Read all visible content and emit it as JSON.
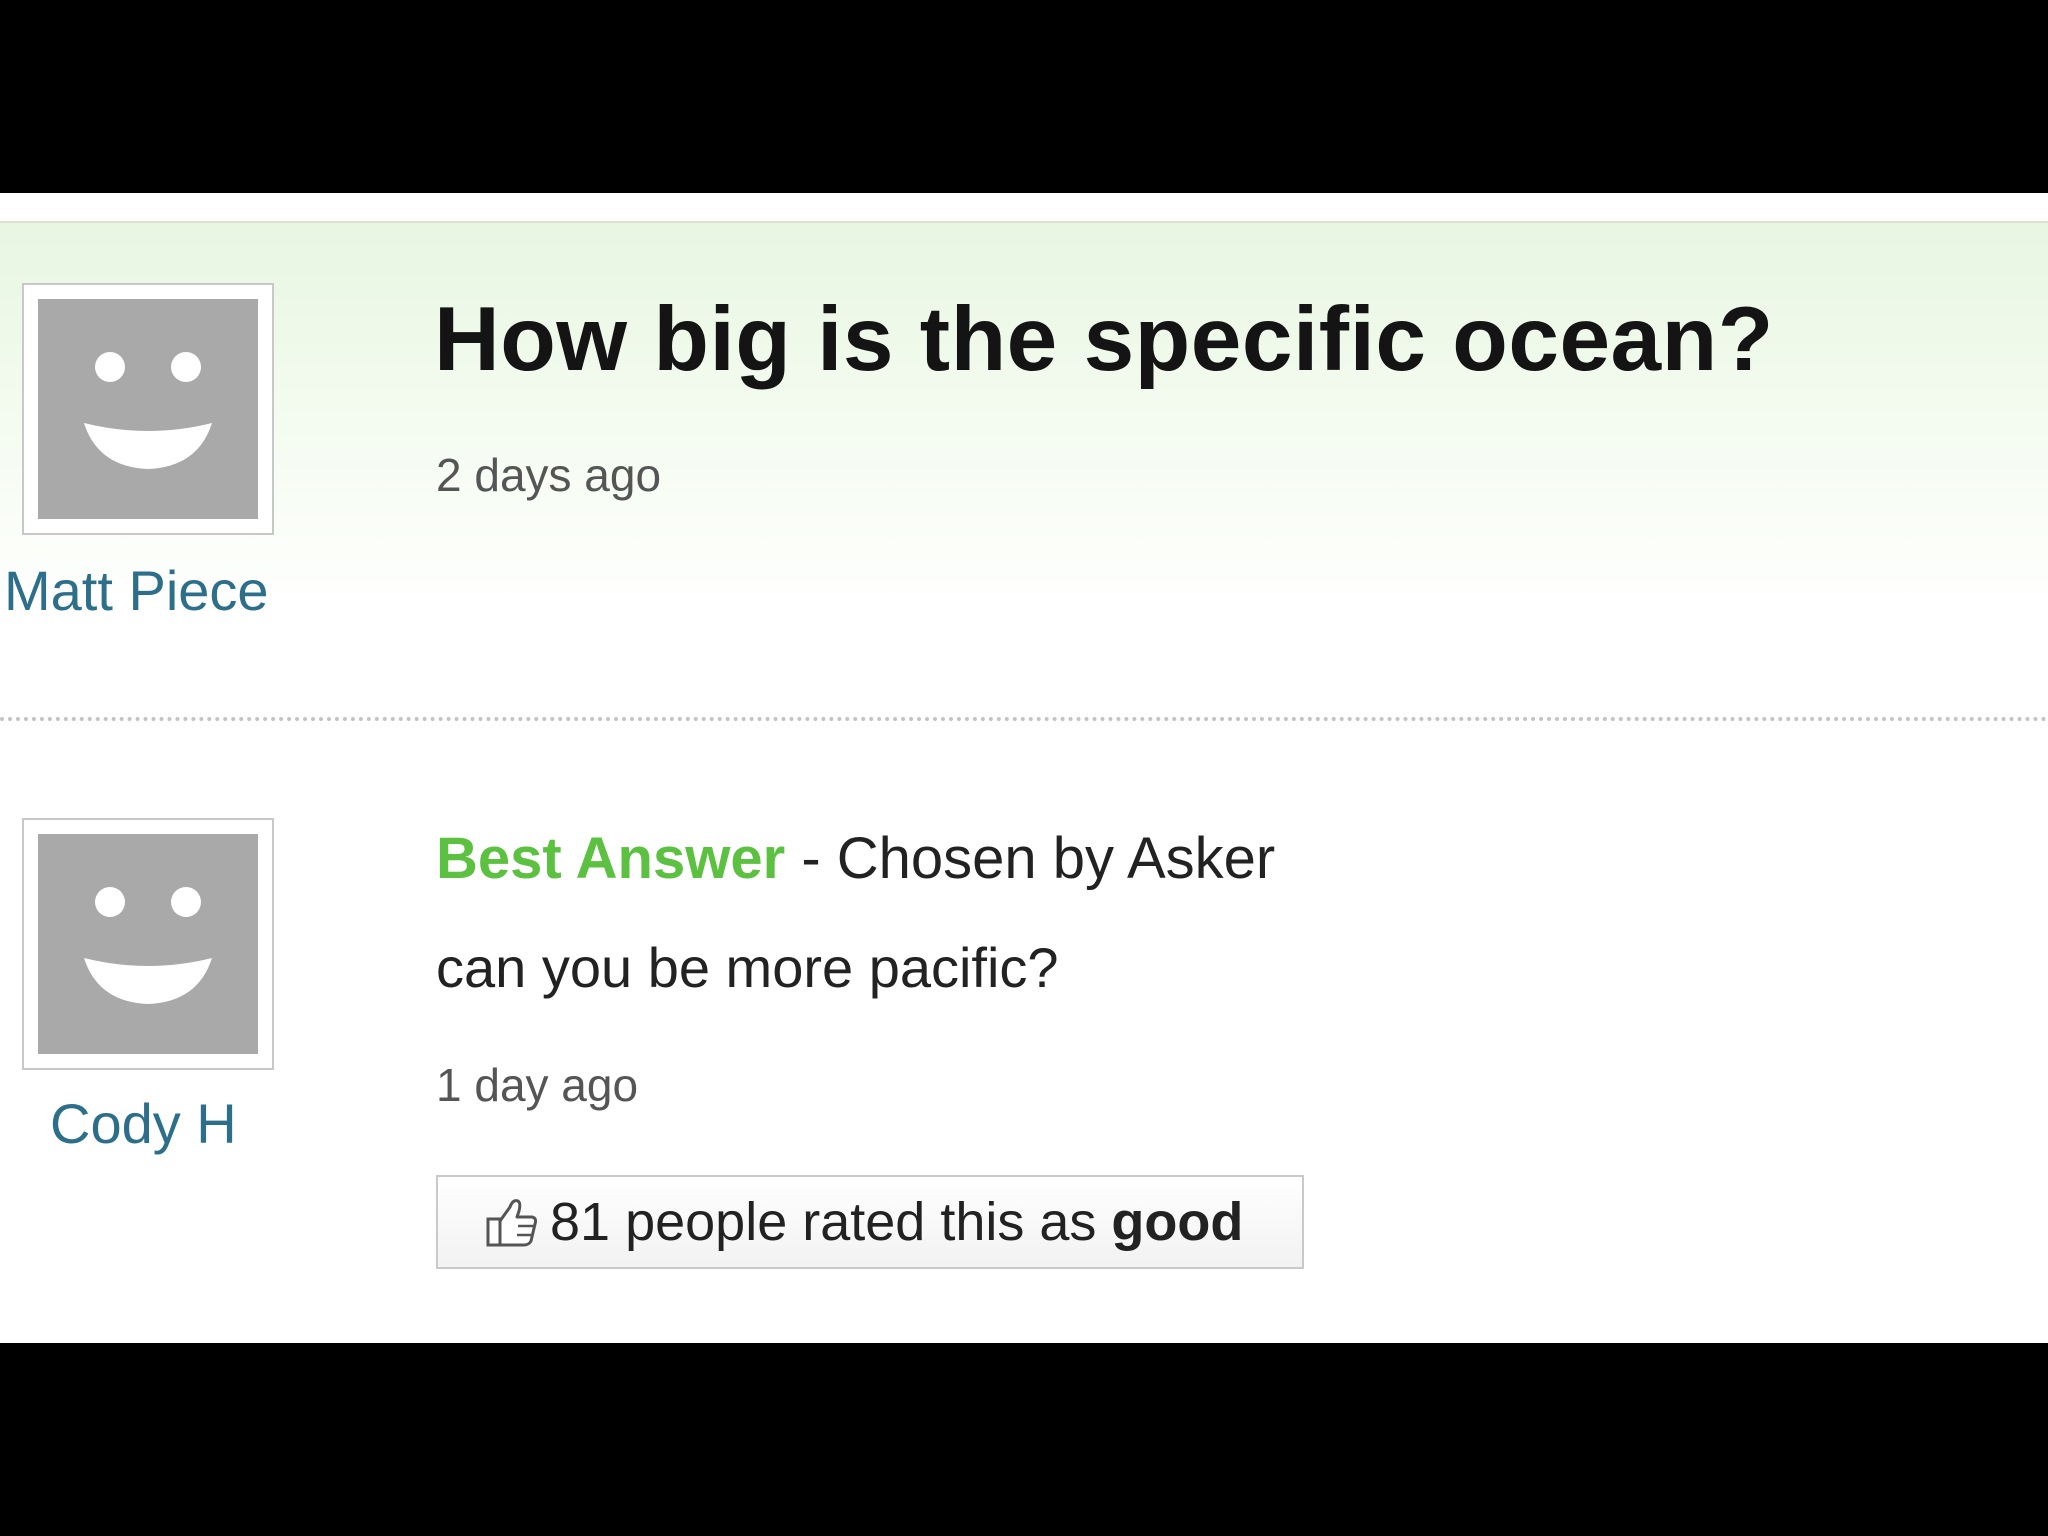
{
  "question": {
    "asker_name": "Matt Piece",
    "title": "How big is the specific ocean?",
    "time_ago": "2 days ago"
  },
  "answer": {
    "answerer_name": "Cody H",
    "best_label": "Best Answer",
    "separator": " - ",
    "chosen_text": "Chosen by Asker",
    "text": "can you be more pacific?",
    "time_ago": "1 day ago",
    "rating_prefix": "81 people rated this as ",
    "rating_word": "good"
  },
  "icons": {
    "avatar": "smiley-face-icon",
    "rating": "thumbs-up-icon"
  },
  "colors": {
    "best_answer_green": "#5cc140",
    "username_blue": "#2d6f8a",
    "avatar_gray": "#a9a9a9"
  }
}
